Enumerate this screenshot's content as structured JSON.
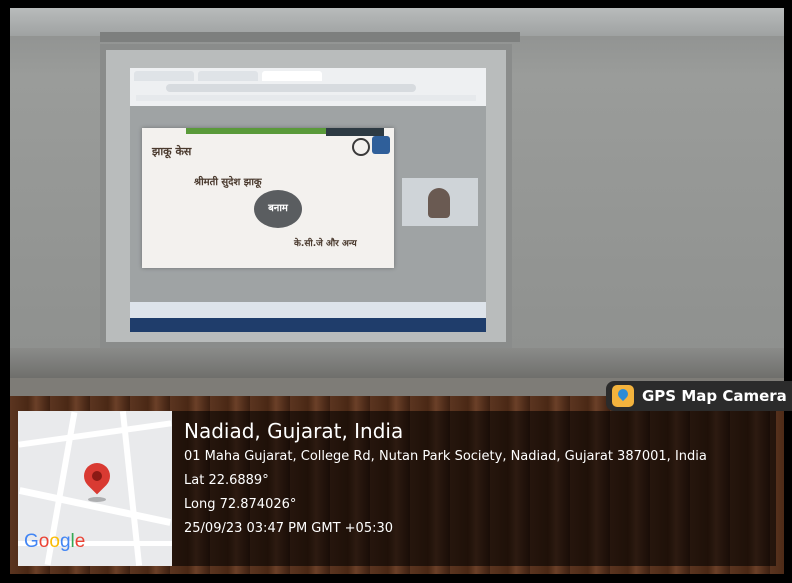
{
  "slide": {
    "title": "झाकू केस",
    "party1": "श्रीमती सुदेश झाकू",
    "versus": "बनाम",
    "party2": "के.सी.जे और अन्य"
  },
  "gps_camera": {
    "badge_label": "GPS Map Camera",
    "map_brand": "Google",
    "location_title": "Nadiad, Gujarat, India",
    "address": "01 Maha Gujarat, College Rd, Nutan Park Society, Nadiad, Gujarat 387001, India",
    "lat": "Lat 22.6889°",
    "long": "Long 72.874026°",
    "datetime": "25/09/23 03:47 PM GMT +05:30"
  },
  "colors": {
    "pin": "#d93a32",
    "badge_bg": "#2b2b2b",
    "slide_bar": "#5a9a3a"
  }
}
